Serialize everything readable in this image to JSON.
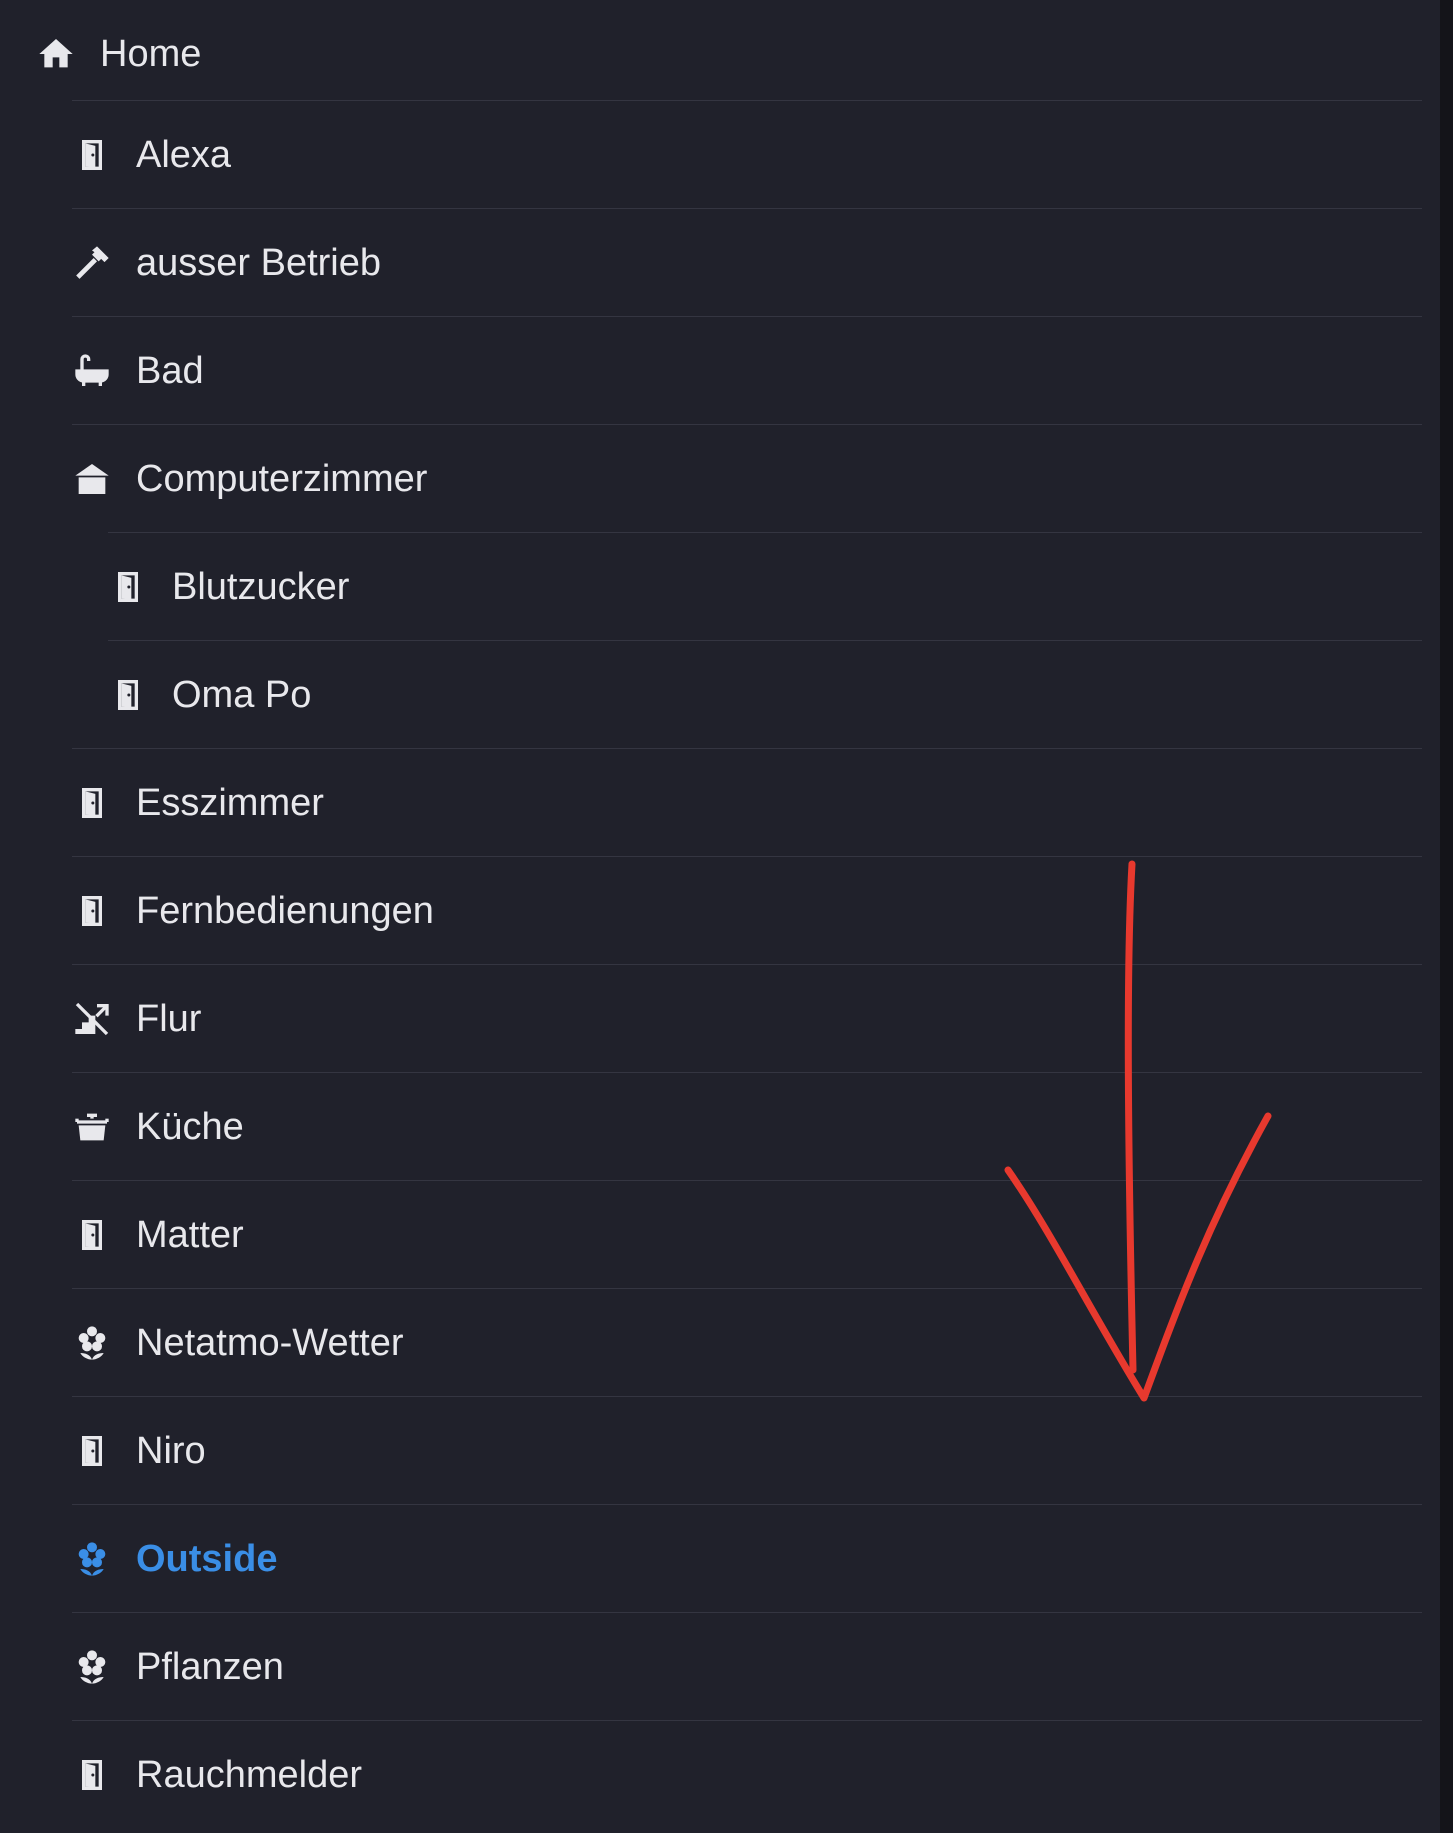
{
  "sidebar": {
    "home": {
      "label": "Home",
      "icon": "home-icon"
    },
    "items": [
      {
        "label": "Alexa",
        "icon": "door-icon",
        "level": 1
      },
      {
        "label": "ausser Betrieb",
        "icon": "hammer-icon",
        "level": 1
      },
      {
        "label": "Bad",
        "icon": "bathtub-icon",
        "level": 1
      },
      {
        "label": "Computerzimmer",
        "icon": "room-icon",
        "level": 1
      },
      {
        "label": "Blutzucker",
        "icon": "door-icon",
        "level": 2
      },
      {
        "label": "Oma Po",
        "icon": "door-icon",
        "level": 2
      },
      {
        "label": "Esszimmer",
        "icon": "door-icon",
        "level": 1
      },
      {
        "label": "Fernbedienungen",
        "icon": "door-icon",
        "level": 1
      },
      {
        "label": "Flur",
        "icon": "stairs-icon",
        "level": 1
      },
      {
        "label": "Küche",
        "icon": "pot-icon",
        "level": 1
      },
      {
        "label": "Matter",
        "icon": "door-icon",
        "level": 1
      },
      {
        "label": "Netatmo-Wetter",
        "icon": "flower-icon",
        "level": 1
      },
      {
        "label": "Niro",
        "icon": "door-icon",
        "level": 1
      },
      {
        "label": "Outside",
        "icon": "flower-icon",
        "level": 1,
        "active": true
      },
      {
        "label": "Pflanzen",
        "icon": "flower-icon",
        "level": 1
      },
      {
        "label": "Rauchmelder",
        "icon": "door-icon",
        "level": 1
      }
    ]
  },
  "colors": {
    "background": "#20212b",
    "text": "#e8e8ec",
    "active": "#3a8ee6",
    "divider": "#343541",
    "annotation": "#e8392e"
  }
}
